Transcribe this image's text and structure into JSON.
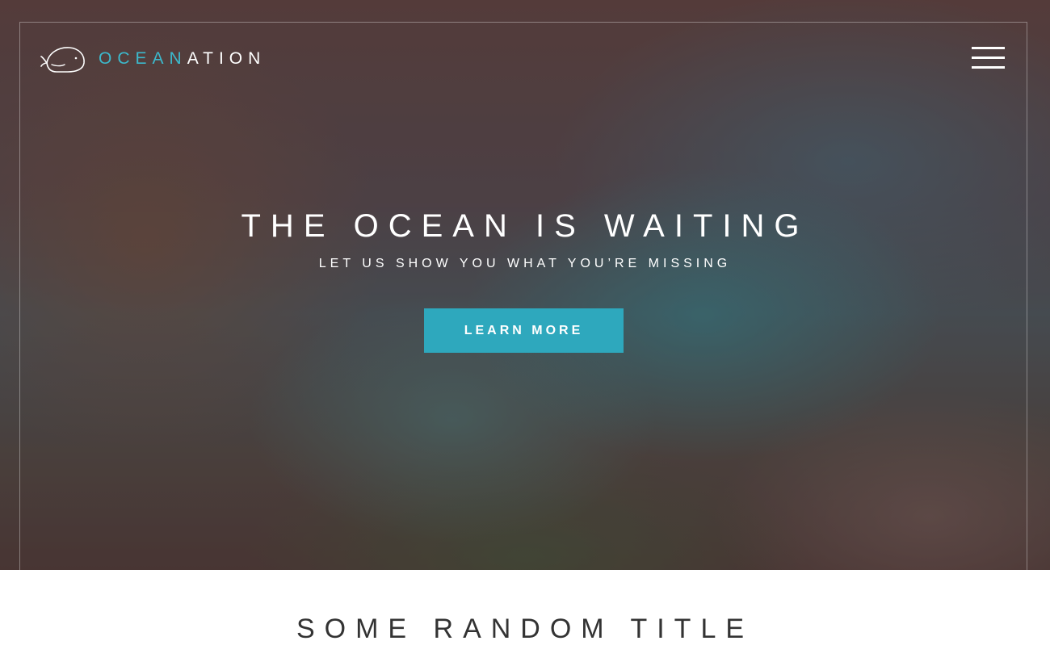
{
  "brand": {
    "name_accent": "OCEAN",
    "name_rest": "ATION",
    "accent_color": "#3cb9cc",
    "icon": "whale-icon"
  },
  "nav": {
    "menu_icon": "hamburger-menu-icon"
  },
  "hero": {
    "title": "THE OCEAN IS WAITING",
    "subtitle": "LET US SHOW YOU WHAT YOU’RE MISSING",
    "cta_label": "LEARN MORE",
    "cta_color": "#2ea8bd",
    "background": "coastal cliffs and ocean photo"
  },
  "section": {
    "title": "SOME RANDOM TITLE"
  }
}
